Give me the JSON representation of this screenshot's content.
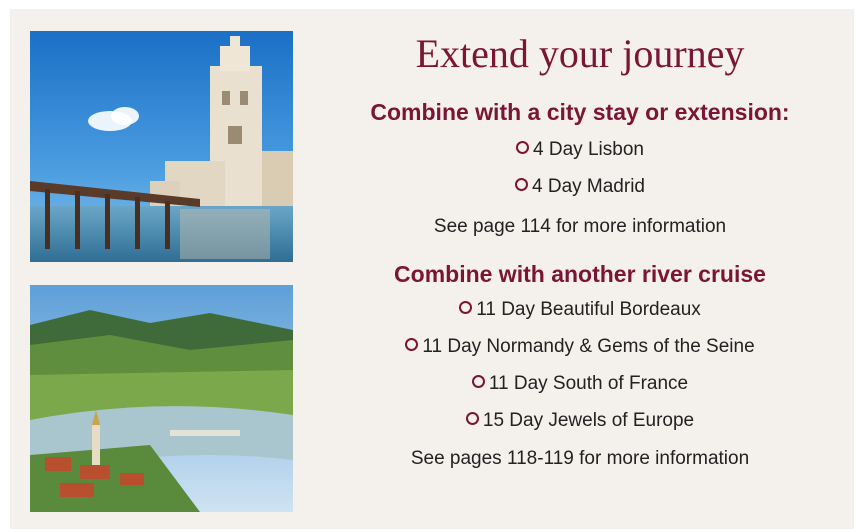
{
  "title": "Extend your journey",
  "section1": {
    "heading": "Combine with a city stay or extension:",
    "items": [
      "4 Day Lisbon",
      "4 Day Madrid"
    ],
    "note": "See page 114 for more information"
  },
  "section2": {
    "heading": "Combine with another river cruise",
    "items": [
      "11 Day Beautiful Bordeaux",
      "11 Day Normandy & Gems of the Seine",
      "11 Day South of France",
      "15 Day Jewels of Europe"
    ],
    "note": "See pages 118-119 for more information"
  },
  "colors": {
    "accent": "#7a1535",
    "panel": "#f4f0ec"
  }
}
